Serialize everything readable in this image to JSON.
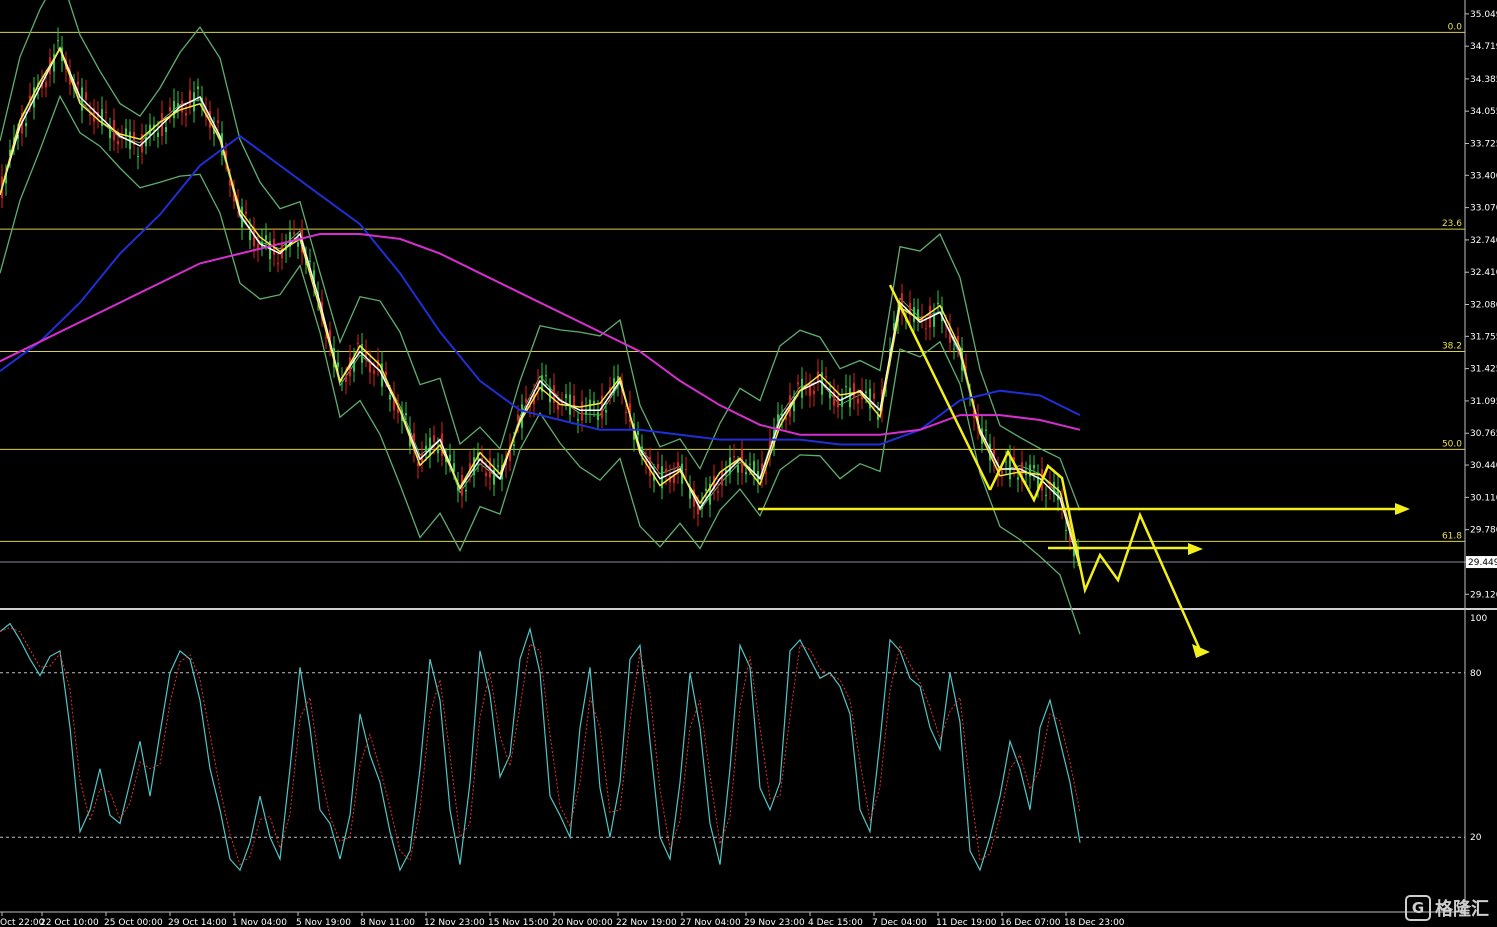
{
  "chart_data": {
    "type": "candlestick",
    "price_axis": {
      "ticks": [
        "35.049",
        "34.719",
        "34.385",
        "34.055",
        "33.725",
        "33.400",
        "33.070",
        "32.740",
        "32.410",
        "32.080",
        "31.755",
        "31.425",
        "31.095",
        "30.765",
        "30.440",
        "30.110",
        "29.780",
        "29.449",
        "29.120"
      ],
      "ylim": [
        29.0,
        35.15
      ],
      "current_price": "29.449"
    },
    "fibonacci_levels": [
      {
        "label": "0.0",
        "price": 34.86
      },
      {
        "label": "23.6",
        "price": 32.85
      },
      {
        "label": "38.2",
        "price": 31.6
      },
      {
        "label": "50.0",
        "price": 30.6
      },
      {
        "label": "61.8",
        "price": 29.66
      }
    ],
    "time_axis": {
      "labels": [
        "Oct 22:00",
        "22 Oct 10:00",
        "25 Oct 00:00",
        "29 Oct 14:00",
        "1 Nov 04:00",
        "5 Nov 19:00",
        "8 Nov 11:00",
        "12 Nov 23:00",
        "15 Nov 15:00",
        "20 Nov 00:00",
        "22 Nov 19:00",
        "27 Nov 04:00",
        "29 Nov 23:00",
        "4 Dec 15:00",
        "7 Dec 04:00",
        "11 Dec 19:00",
        "16 Dec 07:00",
        "18 Dec 23:00"
      ]
    },
    "price_series": [
      {
        "name": "close",
        "x": [
          0,
          20,
          40,
          60,
          80,
          100,
          120,
          140,
          160,
          180,
          200,
          220,
          240,
          260,
          280,
          300,
          320,
          340,
          360,
          380,
          400,
          420,
          440,
          460,
          480,
          500,
          520,
          540,
          560,
          580,
          600,
          620,
          640,
          660,
          680,
          700,
          720,
          740,
          760,
          780,
          800,
          820,
          840,
          860,
          880,
          900,
          920,
          940,
          960,
          980,
          1000,
          1020,
          1040,
          1060,
          1080
        ],
        "y": [
          33.2,
          33.9,
          34.3,
          34.7,
          34.2,
          34.0,
          33.8,
          33.7,
          33.9,
          34.1,
          34.2,
          33.8,
          33.0,
          32.7,
          32.6,
          32.8,
          32.1,
          31.3,
          31.6,
          31.4,
          31.0,
          30.5,
          30.7,
          30.2,
          30.5,
          30.3,
          30.9,
          31.3,
          31.1,
          31.0,
          31.0,
          31.3,
          30.6,
          30.3,
          30.4,
          30.0,
          30.3,
          30.5,
          30.3,
          30.9,
          31.2,
          31.3,
          31.1,
          31.2,
          31.0,
          32.1,
          31.9,
          32.0,
          31.6,
          30.8,
          30.4,
          30.4,
          30.3,
          30.1,
          29.4
        ]
      },
      {
        "name": "ma_blue",
        "x": [
          0,
          40,
          80,
          120,
          160,
          200,
          240,
          280,
          320,
          360,
          400,
          440,
          480,
          520,
          560,
          600,
          640,
          680,
          720,
          760,
          800,
          840,
          880,
          920,
          960,
          1000,
          1040,
          1080
        ],
        "y": [
          31.4,
          31.7,
          32.1,
          32.6,
          33.0,
          33.5,
          33.8,
          33.5,
          33.2,
          32.9,
          32.4,
          31.8,
          31.3,
          31.0,
          30.9,
          30.8,
          30.8,
          30.75,
          30.7,
          30.7,
          30.7,
          30.65,
          30.65,
          30.8,
          31.1,
          31.2,
          31.15,
          30.95
        ]
      },
      {
        "name": "ma_magenta",
        "x": [
          0,
          40,
          80,
          120,
          160,
          200,
          240,
          280,
          320,
          360,
          400,
          440,
          480,
          520,
          560,
          600,
          640,
          680,
          720,
          760,
          800,
          840,
          880,
          920,
          960,
          1000,
          1040,
          1080
        ],
        "y": [
          31.5,
          31.7,
          31.9,
          32.1,
          32.3,
          32.5,
          32.6,
          32.7,
          32.8,
          32.8,
          32.75,
          32.6,
          32.4,
          32.2,
          32.0,
          31.8,
          31.6,
          31.3,
          31.05,
          30.85,
          30.75,
          30.75,
          30.75,
          30.8,
          30.95,
          30.95,
          30.9,
          30.8
        ]
      }
    ],
    "oscillator": {
      "name": "stochastic",
      "levels": [
        "100",
        "80",
        "20"
      ],
      "ylim": [
        0,
        100
      ],
      "x": [
        0,
        10,
        20,
        30,
        40,
        50,
        60,
        70,
        80,
        90,
        100,
        110,
        120,
        130,
        140,
        150,
        160,
        170,
        180,
        190,
        200,
        210,
        220,
        230,
        240,
        250,
        260,
        270,
        280,
        290,
        300,
        310,
        320,
        330,
        340,
        350,
        360,
        370,
        380,
        390,
        400,
        410,
        420,
        430,
        440,
        450,
        460,
        470,
        480,
        490,
        500,
        510,
        520,
        530,
        540,
        550,
        560,
        570,
        580,
        590,
        600,
        610,
        620,
        630,
        640,
        650,
        660,
        670,
        680,
        690,
        700,
        710,
        720,
        730,
        740,
        750,
        760,
        770,
        780,
        790,
        800,
        810,
        820,
        830,
        840,
        850,
        860,
        870,
        880,
        890,
        900,
        910,
        920,
        930,
        940,
        950,
        960,
        970,
        980,
        990,
        1000,
        1010,
        1020,
        1030,
        1040,
        1050,
        1060,
        1070,
        1080
      ],
      "values": [
        95,
        98,
        92,
        85,
        79,
        86,
        88,
        60,
        22,
        30,
        45,
        28,
        25,
        40,
        55,
        35,
        58,
        80,
        88,
        85,
        70,
        45,
        30,
        12,
        8,
        18,
        35,
        20,
        12,
        45,
        82,
        60,
        30,
        25,
        12,
        28,
        65,
        50,
        40,
        22,
        8,
        15,
        45,
        85,
        70,
        30,
        10,
        40,
        88,
        72,
        42,
        50,
        85,
        96,
        80,
        35,
        28,
        20,
        60,
        82,
        38,
        20,
        40,
        85,
        90,
        55,
        20,
        12,
        40,
        80,
        60,
        25,
        10,
        45,
        90,
        82,
        38,
        30,
        40,
        88,
        92,
        85,
        78,
        80,
        75,
        65,
        30,
        22,
        55,
        92,
        88,
        78,
        75,
        60,
        52,
        80,
        62,
        15,
        8,
        20,
        35,
        55,
        45,
        30,
        60,
        70,
        55,
        40,
        18
      ]
    },
    "annotations": []
  }
}
